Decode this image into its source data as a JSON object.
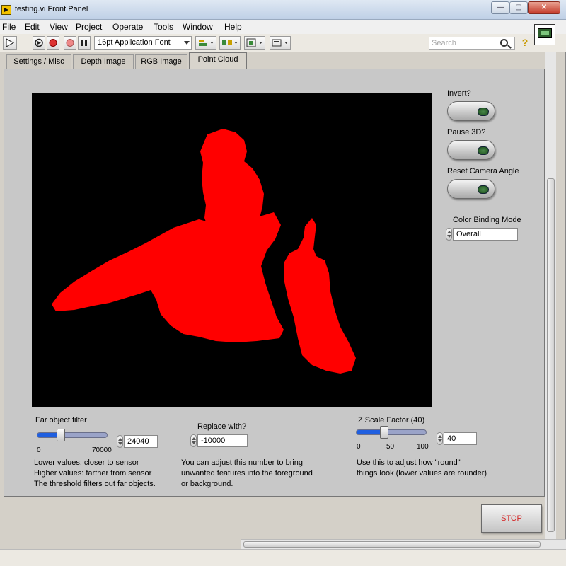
{
  "window": {
    "title": "testing.vi Front Panel",
    "close_glyph": "✕",
    "minimize_glyph": "—",
    "maximize_glyph": "▢"
  },
  "menu": [
    "File",
    "Edit",
    "View",
    "Project",
    "Operate",
    "Tools",
    "Window",
    "Help"
  ],
  "toolbar": {
    "font_select": "16pt Application Font",
    "search_placeholder": "Search",
    "help_glyph": "?"
  },
  "tabs": [
    "Settings / Misc",
    "Depth Image",
    "RGB Image",
    "Point Cloud"
  ],
  "active_tab": "Point Cloud",
  "controls": {
    "invert_label": "Invert?",
    "pause_label": "Pause 3D?",
    "reset_camera_label": "Reset Camera Angle",
    "color_binding_label": "Color Binding Mode",
    "color_binding_value": "Overall",
    "far_filter_label": "Far object filter",
    "far_filter_min": "0",
    "far_filter_max": "70000",
    "far_filter_value": "24040",
    "far_filter_fraction": 0.34,
    "far_filter_notes": [
      "Lower values: closer to sensor",
      "Higher values: farther from sensor",
      "The threshold filters out far objects."
    ],
    "replace_label": "Replace with?",
    "replace_value": "-10000",
    "replace_notes": [
      "You can adjust this number to bring",
      "unwanted features into the foreground",
      "or background."
    ],
    "zscale_label": "Z Scale Factor (40)",
    "zscale_ticks": [
      "0",
      "50",
      "100"
    ],
    "zscale_value": "40",
    "zscale_fraction": 0.4,
    "zscale_notes": [
      "Use this to adjust how \"round\"",
      "things look (lower values are rounder)"
    ],
    "stop_label": "STOP"
  },
  "colors": {
    "point_cloud": "#ff0000",
    "scope_background": "#000000",
    "slider_fill": "#1f5fe0"
  }
}
